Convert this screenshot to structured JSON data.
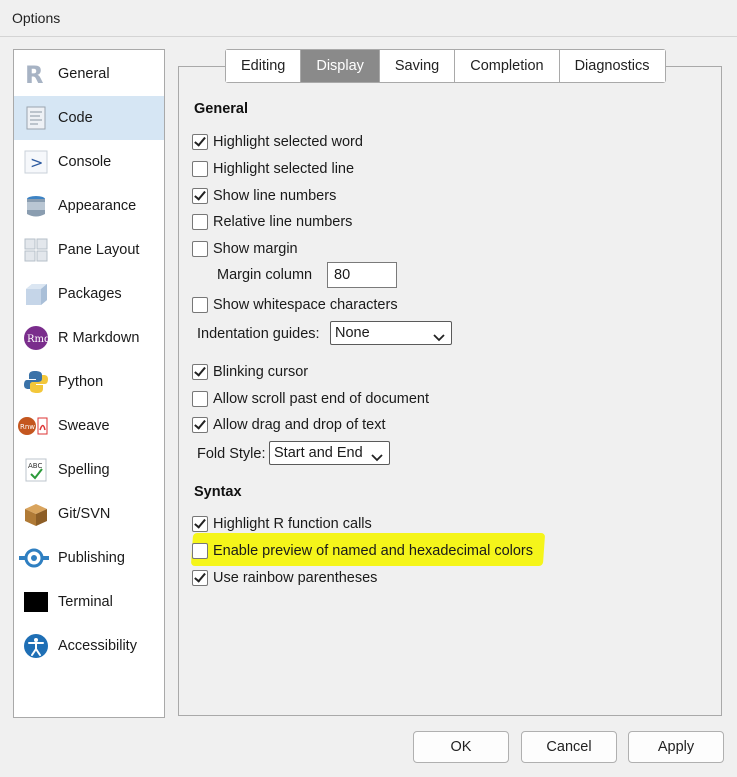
{
  "window": {
    "title": "Options"
  },
  "sidebar": {
    "items": [
      {
        "label": "General",
        "icon": "r-logo-icon"
      },
      {
        "label": "Code",
        "icon": "code-document-icon",
        "active": true
      },
      {
        "label": "Console",
        "icon": "console-prompt-icon"
      },
      {
        "label": "Appearance",
        "icon": "paint-bucket-icon"
      },
      {
        "label": "Pane Layout",
        "icon": "pane-layout-icon"
      },
      {
        "label": "Packages",
        "icon": "package-box-icon"
      },
      {
        "label": "R Markdown",
        "icon": "rmd-icon"
      },
      {
        "label": "Python",
        "icon": "python-icon"
      },
      {
        "label": "Sweave",
        "icon": "sweave-pdf-icon"
      },
      {
        "label": "Spelling",
        "icon": "spelling-abc-icon"
      },
      {
        "label": "Git/SVN",
        "icon": "git-box-icon"
      },
      {
        "label": "Publishing",
        "icon": "publishing-icon"
      },
      {
        "label": "Terminal",
        "icon": "terminal-icon"
      },
      {
        "label": "Accessibility",
        "icon": "accessibility-icon"
      }
    ]
  },
  "tabs": [
    {
      "label": "Editing"
    },
    {
      "label": "Display",
      "active": true
    },
    {
      "label": "Saving"
    },
    {
      "label": "Completion"
    },
    {
      "label": "Diagnostics"
    }
  ],
  "display": {
    "general_heading": "General",
    "highlight_selected_word": {
      "label": "Highlight selected word",
      "checked": true
    },
    "highlight_selected_line": {
      "label": "Highlight selected line",
      "checked": false
    },
    "show_line_numbers": {
      "label": "Show line numbers",
      "checked": true
    },
    "relative_line_numbers": {
      "label": "Relative line numbers",
      "checked": false
    },
    "show_margin": {
      "label": "Show margin",
      "checked": false
    },
    "margin_column": {
      "label": "Margin column",
      "value": "80"
    },
    "show_whitespace": {
      "label": "Show whitespace characters",
      "checked": false
    },
    "indentation_guides": {
      "label": "Indentation guides:",
      "value": "None"
    },
    "blinking_cursor": {
      "label": "Blinking cursor",
      "checked": true
    },
    "allow_scroll_past_end": {
      "label": "Allow scroll past end of document",
      "checked": false
    },
    "allow_drag_drop": {
      "label": "Allow drag and drop of text",
      "checked": true
    },
    "fold_style": {
      "label": "Fold Style:",
      "value": "Start and End"
    },
    "syntax_heading": "Syntax",
    "highlight_r_function_calls": {
      "label": "Highlight R function calls",
      "checked": true
    },
    "enable_color_preview": {
      "label": "Enable preview of named and hexadecimal colors",
      "checked": false
    },
    "rainbow_parentheses": {
      "label": "Use rainbow parentheses",
      "checked": true
    }
  },
  "buttons": {
    "ok": "OK",
    "cancel": "Cancel",
    "apply": "Apply"
  },
  "colors": {
    "highlight": "#f5f51a",
    "active_tab": "#8a8a8a",
    "active_sidebar": "#d6e6f4"
  }
}
